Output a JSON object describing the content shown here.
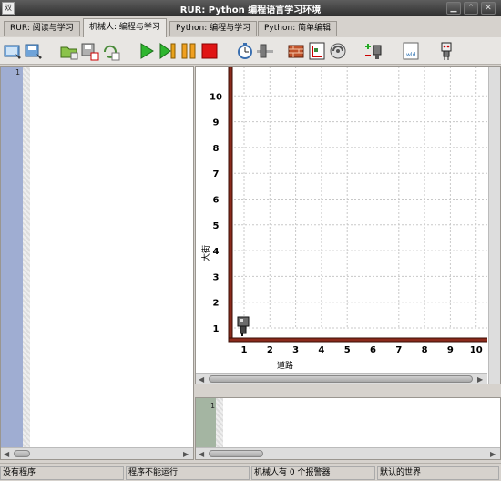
{
  "window": {
    "title": "RUR: Python 编程语言学习环境",
    "icon_text": "双"
  },
  "tabs": [
    {
      "label": "RUR: 阅读与学习"
    },
    {
      "label": "机械人: 编程与学习"
    },
    {
      "label": "Python: 编程与学习"
    },
    {
      "label": "Python: 简单编辑"
    }
  ],
  "toolbar": {
    "icons": [
      "open-world-icon",
      "save-world-icon",
      "open-program-icon",
      "save-program-icon",
      "reload-icon",
      "run-icon",
      "step-icon",
      "pause-icon",
      "stop-icon",
      "speed-clock-icon",
      "speed-slider-icon",
      "edit-walls-icon",
      "resize-world-icon",
      "beepers-icon",
      "robot-beepers-icon",
      "world-file-icon",
      "robot-icon"
    ]
  },
  "editor": {
    "line_number": "1"
  },
  "output": {
    "line_number": "1"
  },
  "world": {
    "x_label": "道路",
    "y_label": "大街",
    "x_ticks": [
      "1",
      "2",
      "3",
      "4",
      "5",
      "6",
      "7",
      "8",
      "9",
      "10"
    ],
    "y_ticks": [
      "1",
      "2",
      "3",
      "4",
      "5",
      "6",
      "7",
      "8",
      "9",
      "10"
    ],
    "robot_position": {
      "avenue": 1,
      "street": 1
    },
    "wall_color": "#8b2a1c"
  },
  "status": [
    "没有程序",
    "程序不能运行",
    "机械人有 0 个报警器",
    "默认的世界"
  ]
}
